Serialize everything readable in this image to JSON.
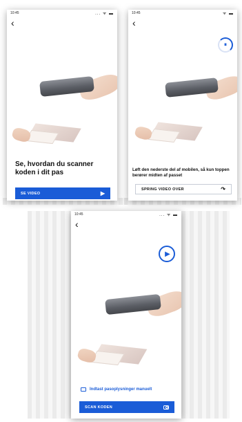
{
  "screens": [
    {
      "status_time": "10:45",
      "status_icons": "... ᯤ ▬",
      "back_icon": "chevron-left",
      "headline": "Se, hvordan du scanner koden i dit pas",
      "button": {
        "label": "SE VIDEO",
        "icon": "▶"
      }
    },
    {
      "status_time": "10:45",
      "status_icons": "ᯤ ▬",
      "back_icon": "chevron-left",
      "pause_icon": "⏸",
      "headline": "Løft den nederste del af mobilen, så kun toppen berører midten af passet",
      "button": {
        "label": "SPRING VIDEO OVER",
        "icon": "↷"
      }
    },
    {
      "status_time": "10:45",
      "status_icons": "... ᯤ ▬",
      "back_icon": "chevron-left",
      "play_icon": "▶",
      "manual_link": "Indtast pasoplysninger manuelt",
      "button": {
        "label": "SCAN KODEN",
        "icon": "📷"
      }
    }
  ],
  "colors": {
    "primary": "#1a5cd7",
    "text": "#111111",
    "background": "#ffffff"
  }
}
